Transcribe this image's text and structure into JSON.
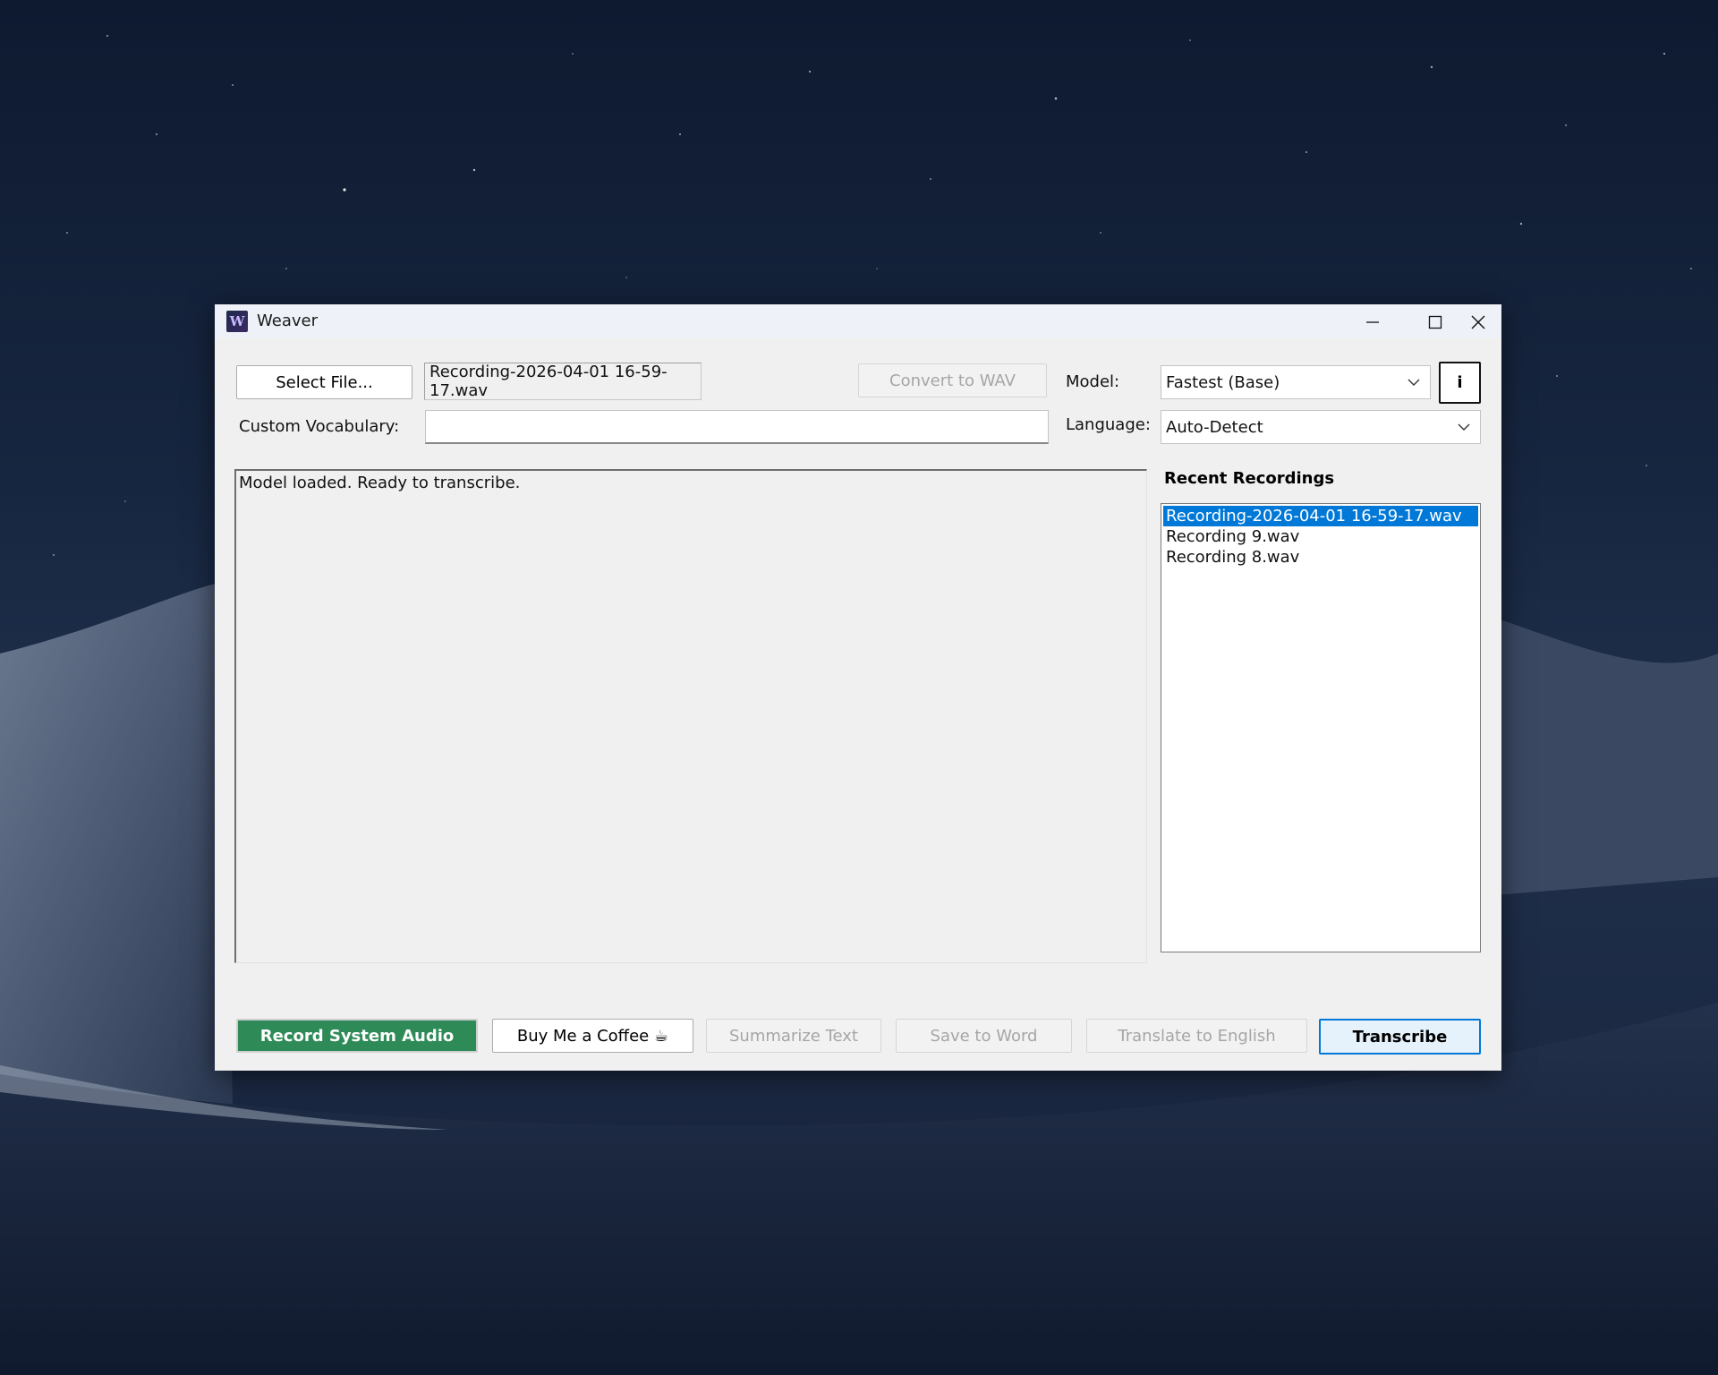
{
  "window": {
    "title": "Weaver",
    "icon": "weaver-app-icon"
  },
  "toolbar": {
    "select_file_label": "Select File...",
    "selected_file": "Recording-2026-04-01 16-59-17.wav",
    "convert_label": "Convert to WAV",
    "model_label": "Model:",
    "model_value": "Fastest (Base)",
    "info_label": "i",
    "vocab_label": "Custom Vocabulary:",
    "vocab_value": "",
    "language_label": "Language:",
    "language_value": "Auto-Detect"
  },
  "output": {
    "text": "Model loaded. Ready to transcribe."
  },
  "recent": {
    "title": "Recent Recordings",
    "items": [
      {
        "label": "Recording-2026-04-01 16-59-17.wav",
        "selected": true
      },
      {
        "label": "Recording 9.wav",
        "selected": false
      },
      {
        "label": "Recording 8.wav",
        "selected": false
      }
    ]
  },
  "actions": {
    "record_label": "Record System Audio",
    "coffee_label": "Buy Me a Coffee ☕",
    "summarize_label": "Summarize Text",
    "save_word_label": "Save to Word",
    "translate_label": "Translate to English",
    "transcribe_label": "Transcribe"
  },
  "colors": {
    "record_bg": "#2e8b57",
    "selection": "#0078d7",
    "transcribe_border": "#0078d7"
  }
}
